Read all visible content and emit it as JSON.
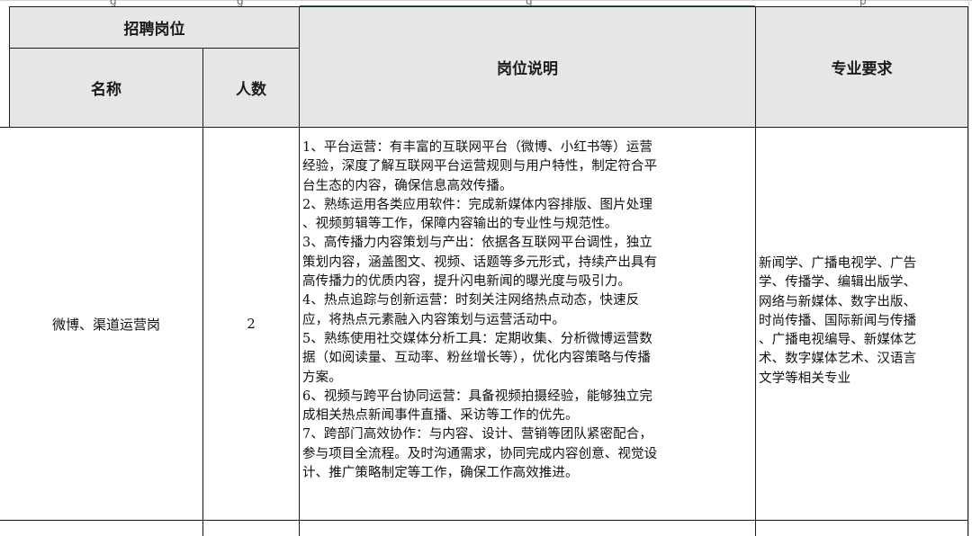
{
  "header": {
    "group_title": "招聘岗位",
    "col_name": "名称",
    "col_count": "人数",
    "col_description": "岗位说明",
    "col_requirements": "专业要求"
  },
  "row": {
    "name": "微博、渠道运营岗",
    "count": "2",
    "description_lines": [
      "1、平台运营：有丰富的互联网平台（微博、小红书等）运营",
      "经验，深度了解互联网平台运营规则与用户特性，制定符合平",
      "台生态的内容，确保信息高效传播。",
      "2、熟练运用各类应用软件：完成新媒体内容排版、图片处理",
      "、视频剪辑等工作，保障内容输出的专业性与规范性。",
      "3、高传播力内容策划与产出：依据各互联网平台调性，独立",
      "策划内容，涵盖图文、视频、话题等多元形式，持续产出具有",
      "高传播力的优质内容，提升闪电新闻的曝光度与吸引力。",
      "4、热点追踪与创新运营：时刻关注网络热点动态，快速反",
      "应，将热点元素融入内容策划与运营活动中。",
      "5、熟练使用社交媒体分析工具：定期收集、分析微博运营数",
      "据（如阅读量、互动率、粉丝增长等），优化内容策略与传播",
      "方案。",
      "6、视频与跨平台协同运营：具备视频拍摄经验，能够独立完",
      "成相关热点新闻事件直播、采访等工作的优先。",
      "7、跨部门高效协作：与内容、设计、营销等团队紧密配合，",
      "参与项目全流程。及时沟通需求，协同完成内容创意、视觉设",
      "计、推广策略制定等工作，确保工作高效推进。"
    ],
    "requirements_lines": [
      "新闻学、广播电视学、广告",
      "学、传播学、编辑出版学、",
      "网络与新媒体、数字出版、",
      "时尚传播、国际新闻与传播",
      "、广播电视编导、新媒体艺",
      "术、数字媒体艺术、汉语言",
      "文学等相关专业"
    ]
  },
  "colors": {
    "header_fill": "#e6e6e6",
    "border": "#1a1a1a",
    "gridline": "#d4d4d4",
    "selection_accent": "#217346"
  }
}
